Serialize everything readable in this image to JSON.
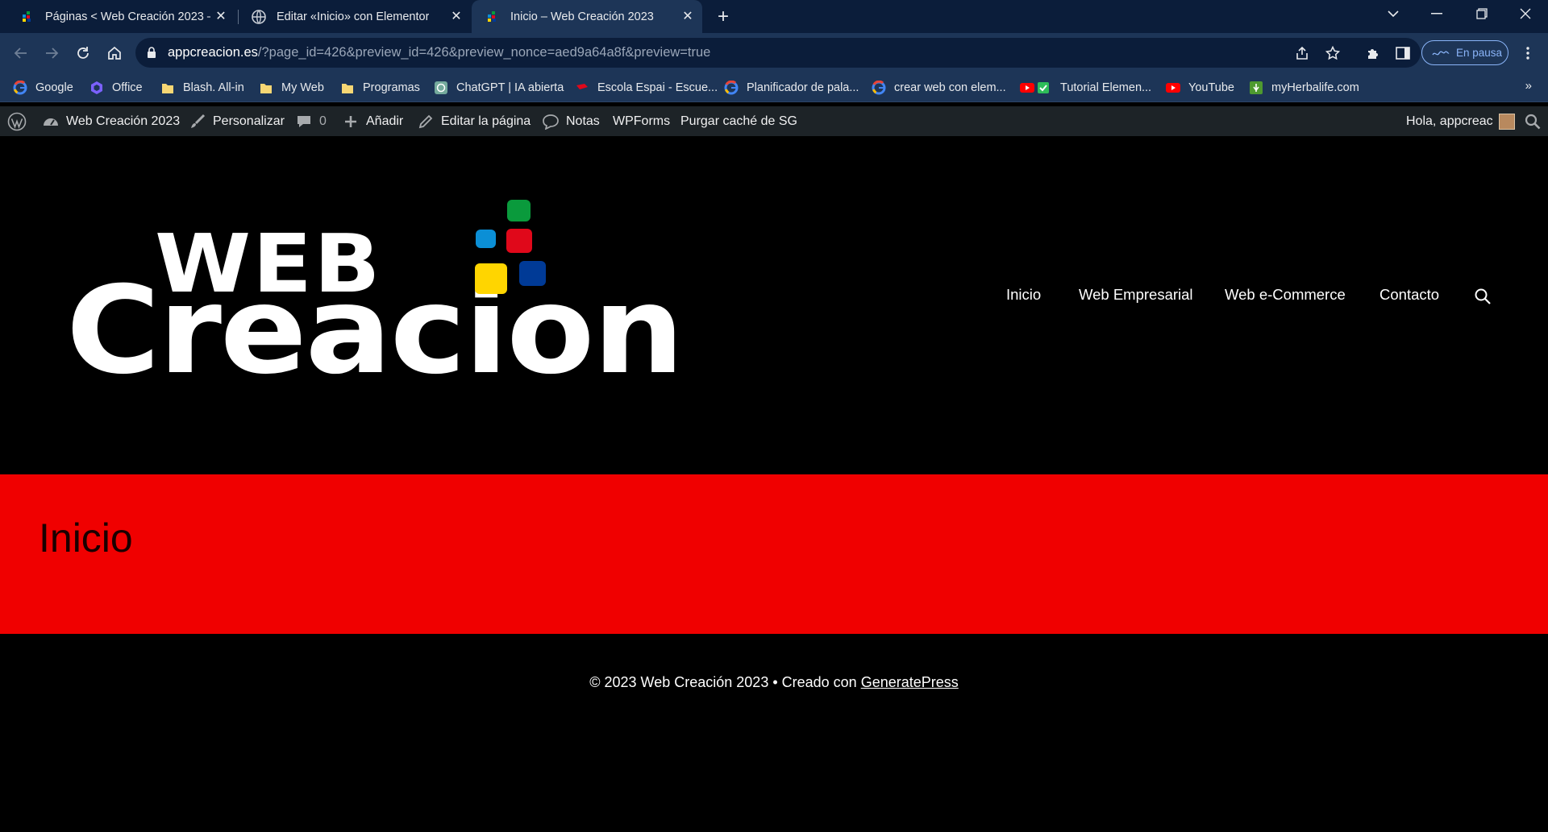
{
  "browser": {
    "tabs": [
      {
        "title": "Páginas < Web Creación 2023 —",
        "active": false
      },
      {
        "title": "Editar «Inicio» con Elementor",
        "active": false
      },
      {
        "title": "Inicio – Web Creación 2023",
        "active": true
      }
    ],
    "url_host": "appcreacion.es",
    "url_rest": "/?page_id=426&preview_id=426&preview_nonce=aed9a64a8f&preview=true",
    "profile_status": "En pausa",
    "bookmarks": [
      {
        "label": "Google",
        "icon": "google-icon"
      },
      {
        "label": "Office",
        "icon": "office-icon"
      },
      {
        "label": "Blash. All-in",
        "icon": "folder-icon"
      },
      {
        "label": "My Web",
        "icon": "folder-icon"
      },
      {
        "label": "Programas",
        "icon": "folder-icon"
      },
      {
        "label": "ChatGPT | IA abierta",
        "icon": "chatgpt-icon"
      },
      {
        "label": "Escola Espai - Escue...",
        "icon": "escola-icon"
      },
      {
        "label": "Planificador de pala...",
        "icon": "google-icon"
      },
      {
        "label": "crear web con elem...",
        "icon": "google-icon"
      },
      {
        "label": "Tutorial Elemen...",
        "icon": "youtube-icon"
      },
      {
        "label": "YouTube",
        "icon": "youtube-icon"
      },
      {
        "label": "myHerbalife.com",
        "icon": "herbalife-icon"
      }
    ],
    "bookmarks_more": "»"
  },
  "adminbar": {
    "site_name": "Web Creación 2023",
    "customize": "Personalizar",
    "comments_count": "0",
    "add_new": "Añadir",
    "edit_page": "Editar la página",
    "notes": "Notas",
    "wpforms": "WPForms",
    "purge_cache": "Purgar caché de SG",
    "greeting": "Hola, appcreac"
  },
  "site": {
    "logo_line1": "WEB",
    "logo_line2": "Creacion",
    "logo_colors": {
      "green": "#0a9a3c",
      "blue": "#0b8fd6",
      "red": "#e0081a",
      "yellow": "#ffd500",
      "navy": "#003a96"
    },
    "nav": [
      "Inicio",
      "Web Empresarial",
      "Web e-Commerce",
      "Contacto"
    ],
    "page_title": "Inicio",
    "title_band_color": "#f00000",
    "footer_text": "© 2023 Web Creación 2023 • Creado con ",
    "footer_link": "GeneratePress"
  }
}
